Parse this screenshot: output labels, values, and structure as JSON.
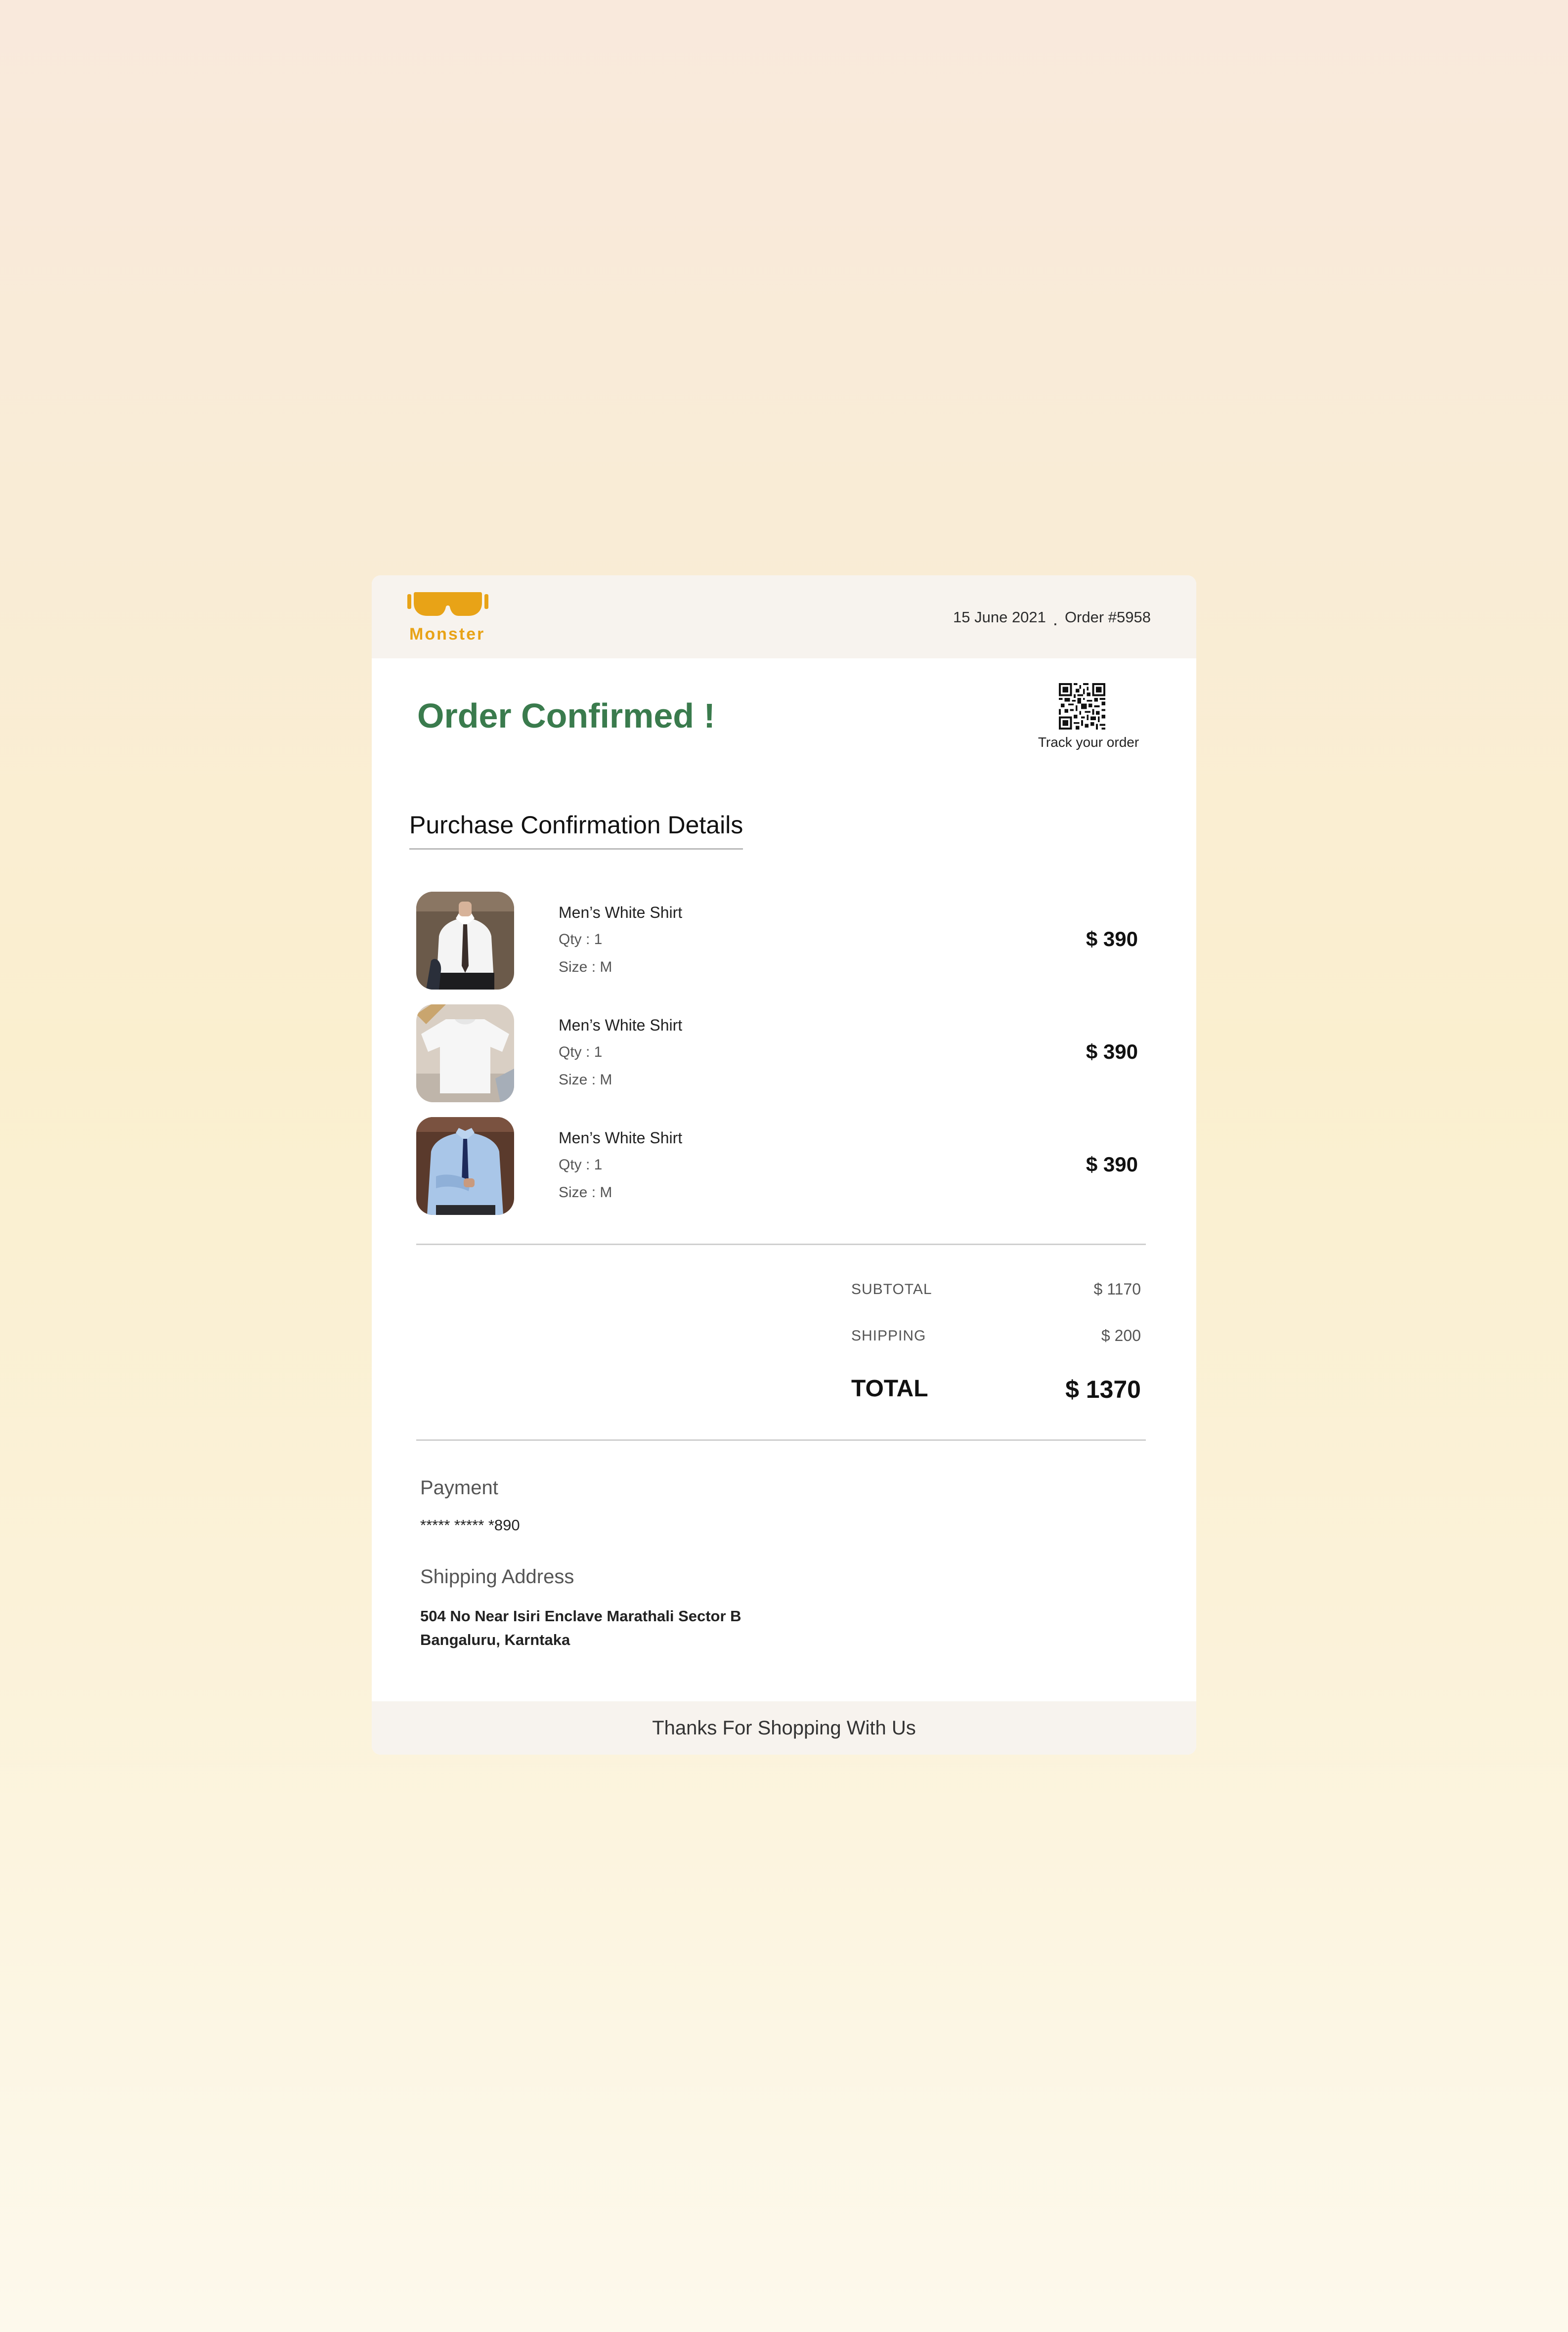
{
  "brand": {
    "name": "Monster",
    "color": "#e8a317"
  },
  "header": {
    "date": "15 June 2021",
    "separator": ".",
    "order": "Order #5958"
  },
  "status": {
    "title": "Order Confirmed !",
    "color": "#3a7b4d"
  },
  "tracking": {
    "icon": "qr-code-icon",
    "label": "Track your order"
  },
  "section_title": "Purchase Confirmation Details",
  "items": [
    {
      "name": "Men’s White Shirt",
      "qty": "Qty : 1",
      "size": "Size : M",
      "price": "$ 390"
    },
    {
      "name": "Men’s White Shirt",
      "qty": "Qty : 1",
      "size": "Size : M",
      "price": "$ 390"
    },
    {
      "name": "Men’s White Shirt",
      "qty": "Qty : 1",
      "size": "Size : M",
      "price": "$ 390"
    }
  ],
  "summary": {
    "subtotal_label": "SUBTOTAL",
    "subtotal_value": "$ 1170",
    "shipping_label": "SHIPPING",
    "shipping_value": "$ 200",
    "total_label": "TOTAL",
    "total_value": "$ 1370"
  },
  "payment": {
    "heading": "Payment",
    "card": "***** ***** *890"
  },
  "shipping_address": {
    "heading": "Shipping Address",
    "line1": "504 No Near Isiri Enclave Marathali  Sector B",
    "line2": "Bangaluru, Karntaka"
  },
  "footer": {
    "text": "Thanks For Shopping With Us"
  }
}
